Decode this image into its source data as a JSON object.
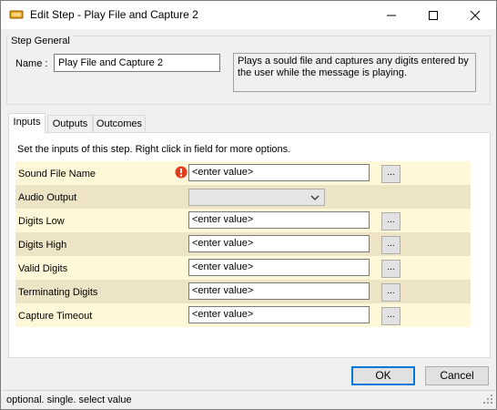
{
  "window": {
    "title": "Edit Step - Play File and Capture 2"
  },
  "step_general": {
    "legend": "Step General",
    "name_label": "Name :",
    "name_value": "Play File and Capture 2",
    "description": "Plays a sould file and captures any digits entered by the user while the message is playing."
  },
  "tabs": [
    {
      "label": "Inputs",
      "active": true
    },
    {
      "label": "Outputs",
      "active": false
    },
    {
      "label": "Outcomes",
      "active": false
    }
  ],
  "inputs_panel": {
    "instructions": "Set the inputs of this step.  Right click in field for more options.",
    "rows": [
      {
        "label": "Sound File Name",
        "value": "<enter value>",
        "type": "text",
        "warning": true
      },
      {
        "label": "Audio Output",
        "value": "",
        "type": "combo",
        "warning": false
      },
      {
        "label": "Digits Low",
        "value": "<enter value>",
        "type": "text",
        "warning": false
      },
      {
        "label": "Digits High",
        "value": "<enter value>",
        "type": "text",
        "warning": false
      },
      {
        "label": "Valid Digits",
        "value": "<enter value>",
        "type": "text",
        "warning": false
      },
      {
        "label": "Terminating Digits",
        "value": "<enter value>",
        "type": "text",
        "warning": false
      },
      {
        "label": "Capture Timeout",
        "value": "<enter value>",
        "type": "text",
        "warning": false
      }
    ],
    "ellipsis_label": "..."
  },
  "buttons": {
    "ok": "OK",
    "cancel": "Cancel"
  },
  "statusbar": {
    "text": "optional. single. select value"
  },
  "colors": {
    "row_light": "#fff8d8",
    "row_dark": "#ece4c4",
    "warning": "#e23b1e",
    "accent": "#0078d7"
  }
}
